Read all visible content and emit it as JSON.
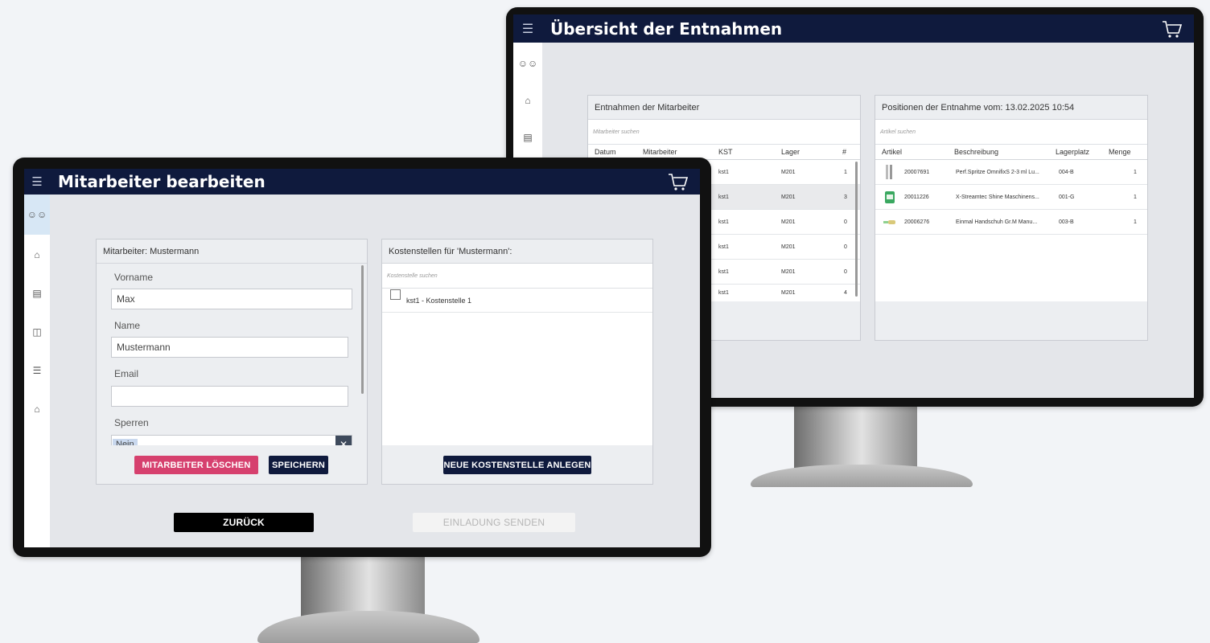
{
  "back_window": {
    "title": "Übersicht der Entnahmen",
    "employees_panel": {
      "title": "Entnahmen der Mitarbeiter",
      "search_placeholder": "Mitarbeiter suchen",
      "columns": [
        "Datum",
        "Mitarbeiter",
        "KST",
        "Lager",
        "#"
      ],
      "rows": [
        {
          "kst": "kst1",
          "lager": "M201",
          "count": "1"
        },
        {
          "kst": "kst1",
          "lager": "M201",
          "count": "3"
        },
        {
          "kst": "kst1",
          "lager": "M201",
          "count": "0"
        },
        {
          "kst": "kst1",
          "lager": "M201",
          "count": "0"
        },
        {
          "kst": "kst1",
          "lager": "M201",
          "count": "0"
        },
        {
          "kst": "kst1",
          "lager": "M201",
          "count": "4"
        }
      ]
    },
    "positions_panel": {
      "title": "Positionen der Entnahme vom: 13.02.2025 10:54",
      "search_placeholder": "Artikel suchen",
      "columns": [
        "Artikel",
        "Beschreibung",
        "Lagerplatz",
        "Menge"
      ],
      "rows": [
        {
          "artikel": "20007691",
          "beschreibung": "Perf.Spritze OmnifixS 2-3 ml Lu...",
          "lagerplatz": "004-B",
          "menge": "1"
        },
        {
          "artikel": "20011226",
          "beschreibung": "X-Streamtec Shine Maschinens...",
          "lagerplatz": "001-G",
          "menge": "1"
        },
        {
          "artikel": "20006276",
          "beschreibung": "Einmal Handschuh Gr.M Manu...",
          "lagerplatz": "003-B",
          "menge": "1"
        }
      ]
    }
  },
  "front_window": {
    "title": "Mitarbeiter bearbeiten",
    "employee_panel": {
      "title": "Mitarbeiter: Mustermann",
      "vorname_label": "Vorname",
      "vorname_value": "Max",
      "name_label": "Name",
      "name_value": "Mustermann",
      "email_label": "Email",
      "email_value": "",
      "sperren_label": "Sperren",
      "sperren_value": "Nein",
      "delete_button": "MITARBEITER LÖSCHEN",
      "save_button": "SPEICHERN"
    },
    "cost_panel": {
      "title": "Kostenstellen für 'Mustermann':",
      "search_placeholder": "Kostenstelle suchen",
      "items": [
        "kst1 - Kostenstelle 1"
      ],
      "new_button": "NEUE KOSTENSTELLE ANLEGEN"
    },
    "back_button": "ZURÜCK",
    "invite_button": "EINLADUNG SENDEN"
  },
  "colors": {
    "titlebar": "#0f1a3d",
    "delete_button": "#d6406e",
    "primary_button": "#0f1a3d",
    "disabled_button": "#f3f3f3"
  }
}
